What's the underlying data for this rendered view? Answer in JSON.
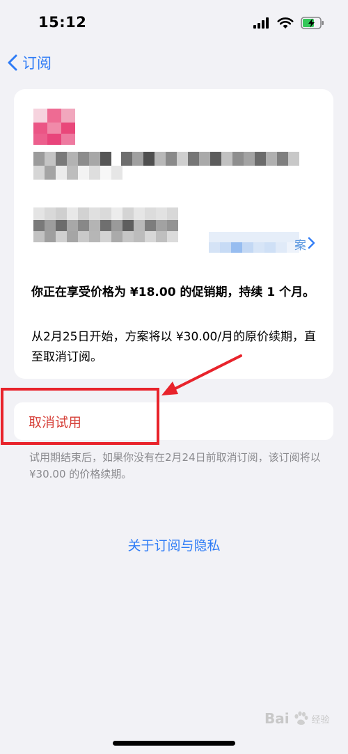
{
  "status_bar": {
    "time": "15:12",
    "icons": [
      "signal-icon",
      "wifi-icon",
      "battery-charging-icon"
    ]
  },
  "nav": {
    "back_label": "订阅",
    "back_icon": "chevron-left-icon"
  },
  "subscription_card": {
    "link_chevron": "›",
    "link_text_fragment": "案",
    "promo_text": "你正在享受价格为 ¥18.00 的促销期，持续 1 个月。",
    "renewal_text": "从2月25日开始，方案将以 ¥30.00/月的原价续期，直至取消订阅。"
  },
  "cancel": {
    "label": "取消试用"
  },
  "footnote": "试用期结束后，如果你没有在2月24日前取消订阅，该订阅将以 ¥30.00 的价格续期。",
  "privacy_link": "关于订阅与隐私",
  "watermark": {
    "text": "Bai",
    "subtext": "经验"
  },
  "colors": {
    "accent": "#2f7cf6",
    "destructive": "#d6413a",
    "annotation": "#e8232b",
    "background": "#f2f2f6"
  }
}
